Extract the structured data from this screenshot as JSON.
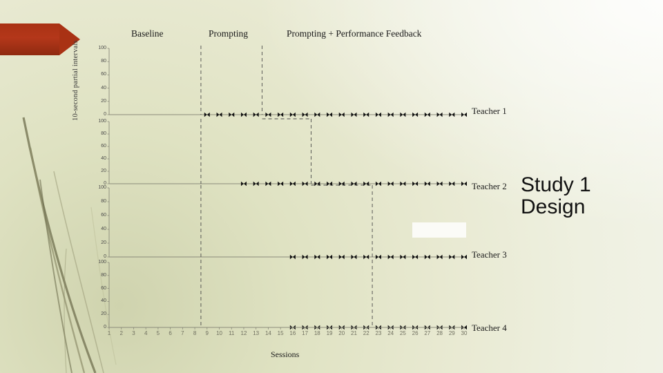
{
  "slide": {
    "title_right_line1": "Study 1",
    "title_right_line2": "Design",
    "accent_color": "#a93214",
    "background_color": "#e9ead3"
  },
  "chart_data": {
    "type": "scatter",
    "title": "",
    "xlabel": "Sessions",
    "ylabel": "10-second partial intervals",
    "xlim": [
      1,
      30
    ],
    "ylim": [
      0,
      100
    ],
    "yticks": [
      0,
      20,
      40,
      60,
      80,
      100
    ],
    "xticks": [
      1,
      2,
      3,
      4,
      5,
      6,
      7,
      8,
      9,
      10,
      11,
      12,
      13,
      14,
      15,
      16,
      17,
      18,
      19,
      20,
      21,
      22,
      23,
      24,
      25,
      26,
      27,
      28,
      29,
      30
    ],
    "grid": false,
    "legend_position": "none",
    "phases": [
      {
        "label": "Baseline",
        "x_start": 1,
        "x_end": 8
      },
      {
        "label": "Prompting",
        "x_start": 9,
        "x_end": 13
      },
      {
        "label": "Prompting + Performance Feedback",
        "x_start": 14,
        "x_end": 30
      }
    ],
    "panels": [
      {
        "name": "Teacher 1",
        "baseline_end_session": 8,
        "prompting_end_session": 13,
        "series": [
          {
            "name": "Teacher 1 data",
            "x": [
              9,
              10,
              11,
              12,
              13,
              14,
              15,
              16,
              17,
              18,
              19,
              20,
              21,
              22,
              23,
              24,
              25,
              26,
              27,
              28,
              29,
              30
            ],
            "values": [
              0,
              0,
              0,
              0,
              0,
              0,
              0,
              0,
              0,
              0,
              0,
              0,
              0,
              0,
              0,
              0,
              0,
              0,
              0,
              0,
              0,
              0
            ]
          }
        ]
      },
      {
        "name": "Teacher 2",
        "baseline_end_session": 8,
        "prompting_end_session": 17,
        "series": [
          {
            "name": "Teacher 2 data",
            "x": [
              12,
              13,
              14,
              15,
              16,
              17,
              18,
              19,
              20,
              21,
              22,
              23,
              24,
              25,
              26,
              27,
              28,
              29,
              30
            ],
            "values": [
              0,
              0,
              0,
              0,
              0,
              0,
              0,
              0,
              0,
              0,
              0,
              0,
              0,
              0,
              0,
              0,
              0,
              0,
              0
            ]
          }
        ]
      },
      {
        "name": "Teacher 3",
        "baseline_end_session": 8,
        "prompting_end_session": 22,
        "series": [
          {
            "name": "Teacher 3 data",
            "x": [
              16,
              17,
              18,
              19,
              20,
              21,
              22,
              23,
              24,
              25,
              26,
              27,
              28,
              29,
              30
            ],
            "values": [
              0,
              0,
              0,
              0,
              0,
              0,
              0,
              0,
              0,
              0,
              0,
              0,
              0,
              0,
              0
            ]
          }
        ]
      },
      {
        "name": "Teacher 4",
        "baseline_end_session": 8,
        "prompting_end_session": 22,
        "series": [
          {
            "name": "Teacher 4 data",
            "x": [
              16,
              17,
              18,
              19,
              20,
              21,
              22,
              23,
              24,
              25,
              26,
              27,
              28,
              29,
              30
            ],
            "values": [
              0,
              0,
              0,
              0,
              0,
              0,
              0,
              0,
              0,
              0,
              0,
              0,
              0,
              0,
              0
            ]
          }
        ]
      }
    ]
  }
}
